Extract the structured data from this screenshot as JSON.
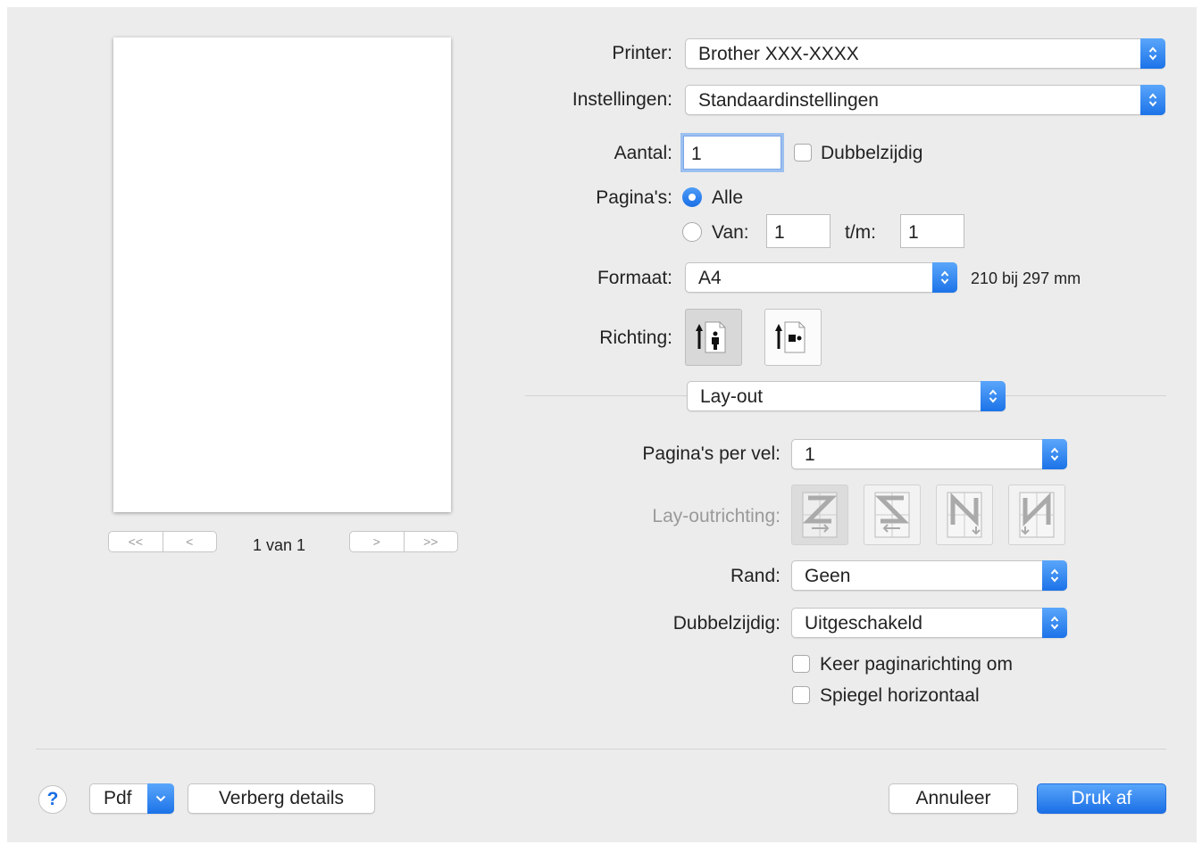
{
  "preview": {
    "page_indicator": "1 van 1",
    "nav": {
      "first": "<<",
      "prev": "<",
      "next": ">",
      "last": ">>"
    }
  },
  "printer": {
    "label": "Printer:",
    "value": "Brother XXX-XXXX"
  },
  "settings": {
    "label": "Instellingen:",
    "value": "Standaardinstellingen"
  },
  "copies": {
    "label": "Aantal:",
    "value": "1",
    "two_sided_label": "Dubbelzijdig",
    "two_sided_checked": false
  },
  "pages": {
    "label": "Pagina's:",
    "all_label": "Alle",
    "range_label": "Van:",
    "from_value": "1",
    "to_label": "t/m:",
    "to_value": "1",
    "selected": "all"
  },
  "paper": {
    "label": "Formaat:",
    "value": "A4",
    "size_text": "210 bij 297 mm"
  },
  "orientation": {
    "label": "Richting:",
    "selected": "portrait",
    "options": [
      "portrait-icon",
      "landscape-icon"
    ]
  },
  "section": {
    "value": "Lay-out"
  },
  "layout": {
    "pages_per_sheet": {
      "label": "Pagina's per vel:",
      "value": "1"
    },
    "layout_direction": {
      "label": "Lay-outrichting:",
      "enabled": false,
      "icons": [
        "z-order-icon",
        "reverse-z-order-icon",
        "n-order-icon",
        "reverse-n-order-icon"
      ]
    },
    "border": {
      "label": "Rand:",
      "value": "Geen"
    },
    "two_sided": {
      "label": "Dubbelzijdig:",
      "value": "Uitgeschakeld"
    },
    "reverse_orientation": {
      "label": "Keer paginarichting om",
      "checked": false
    },
    "flip_horizontal": {
      "label": "Spiegel horizontaal",
      "checked": false
    }
  },
  "footer": {
    "help": "?",
    "pdf": "Pdf",
    "hide_details": "Verberg details",
    "cancel": "Annuleer",
    "print": "Druk af"
  },
  "colors": {
    "accent": "#1a6fe5",
    "background": "#ececec",
    "dim_text": "#9a9a9a"
  }
}
